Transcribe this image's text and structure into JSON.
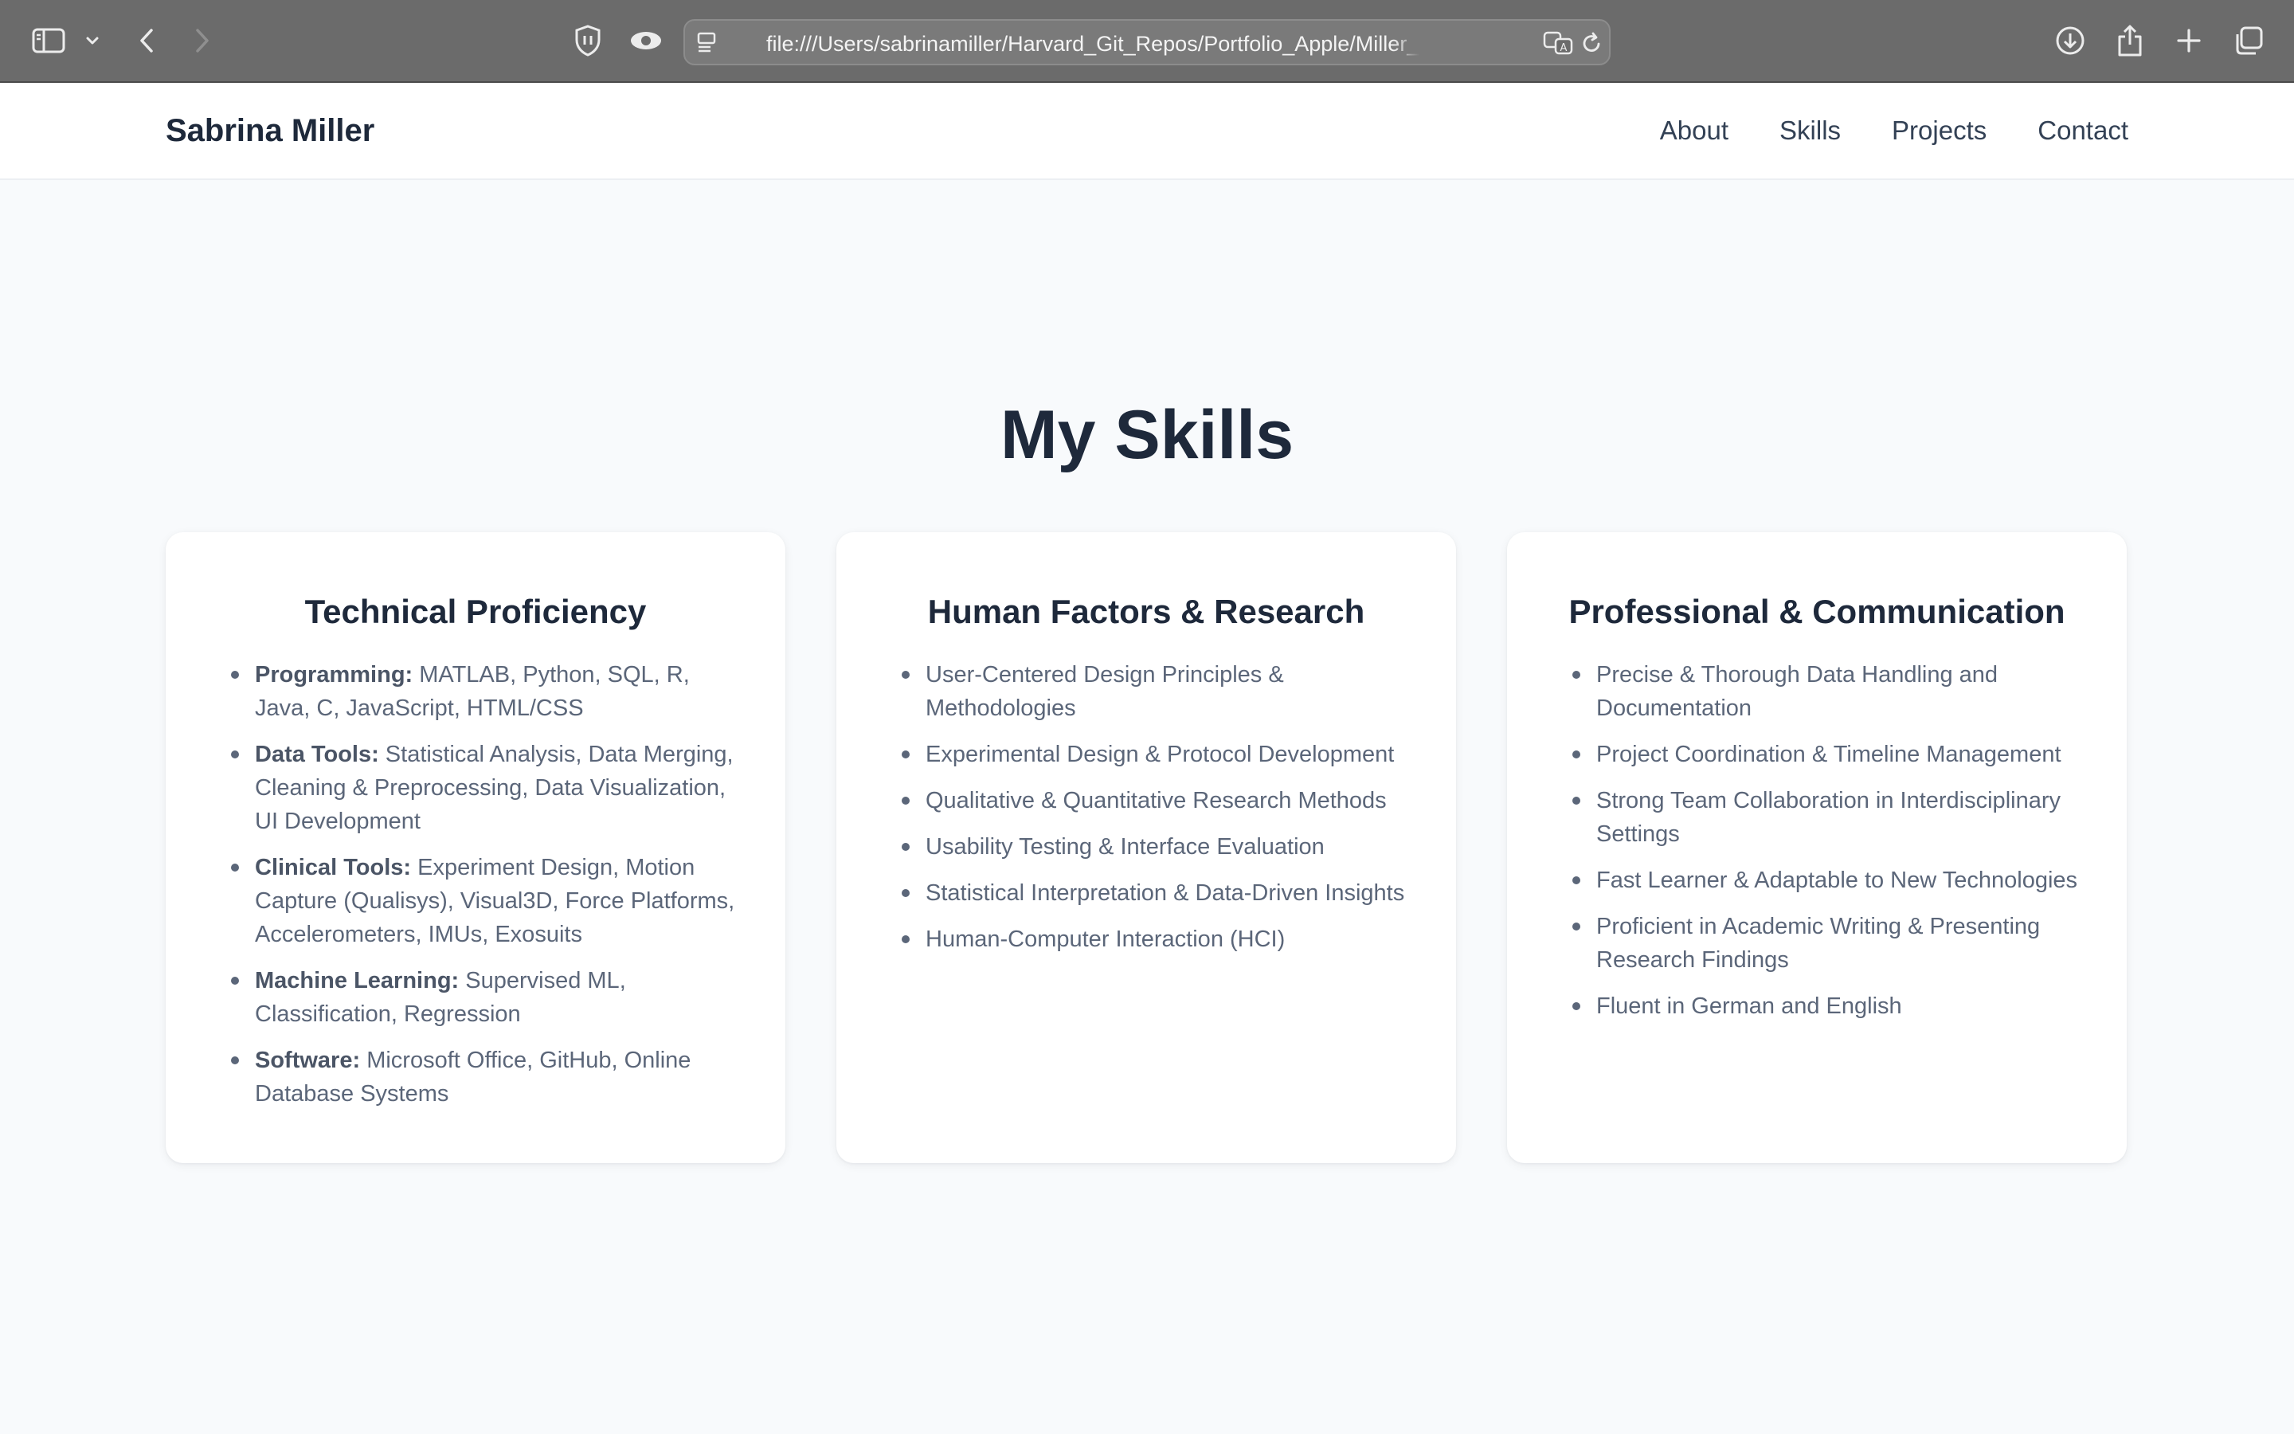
{
  "browser": {
    "url": "file:///Users/sabrinamiller/Harvard_Git_Repos/Portfolio_Apple/Miller_Sabrina_Portfolio",
    "icons": [
      "sidebar-icon",
      "chevron-down-icon",
      "back-icon",
      "forward-icon",
      "shield-icon",
      "eye-icon",
      "page-menu-icon",
      "translate-icon",
      "reload-icon",
      "download-icon",
      "share-icon",
      "plus-icon",
      "tabs-icon"
    ]
  },
  "nav": {
    "brand": "Sabrina Miller",
    "links": [
      "About",
      "Skills",
      "Projects",
      "Contact"
    ]
  },
  "skills": {
    "title": "My Skills",
    "cards": [
      {
        "title": "Technical Proficiency",
        "items": [
          {
            "label": "Programming:",
            "text": " MATLAB, Python, SQL, R, Java, C, JavaScript, HTML/CSS"
          },
          {
            "label": "Data Tools:",
            "text": " Statistical Analysis, Data Merging, Cleaning & Preprocessing, Data Visualization, UI Development"
          },
          {
            "label": "Clinical Tools:",
            "text": " Experiment Design, Motion Capture (Qualisys), Visual3D, Force Platforms, Accelerometers, IMUs, Exosuits"
          },
          {
            "label": "Machine Learning:",
            "text": " Supervised ML, Classification, Regression"
          },
          {
            "label": "Software:",
            "text": " Microsoft Office, GitHub, Online Database Systems"
          }
        ]
      },
      {
        "title": "Human Factors & Research",
        "items": [
          "User-Centered Design Principles & Methodologies",
          "Experimental Design & Protocol Development",
          "Qualitative & Quantitative Research Methods",
          "Usability Testing & Interface Evaluation",
          "Statistical Interpretation & Data-Driven Insights",
          "Human-Computer Interaction (HCI)"
        ]
      },
      {
        "title": "Professional & Communication",
        "items": [
          "Precise & Thorough Data Handling and Documentation",
          "Project Coordination & Timeline Management",
          "Strong Team Collaboration in Interdisciplinary Settings",
          "Fast Learner & Adaptable to New Technologies",
          "Proficient in Academic Writing & Presenting Research Findings",
          "Fluent in German and English"
        ]
      }
    ]
  }
}
